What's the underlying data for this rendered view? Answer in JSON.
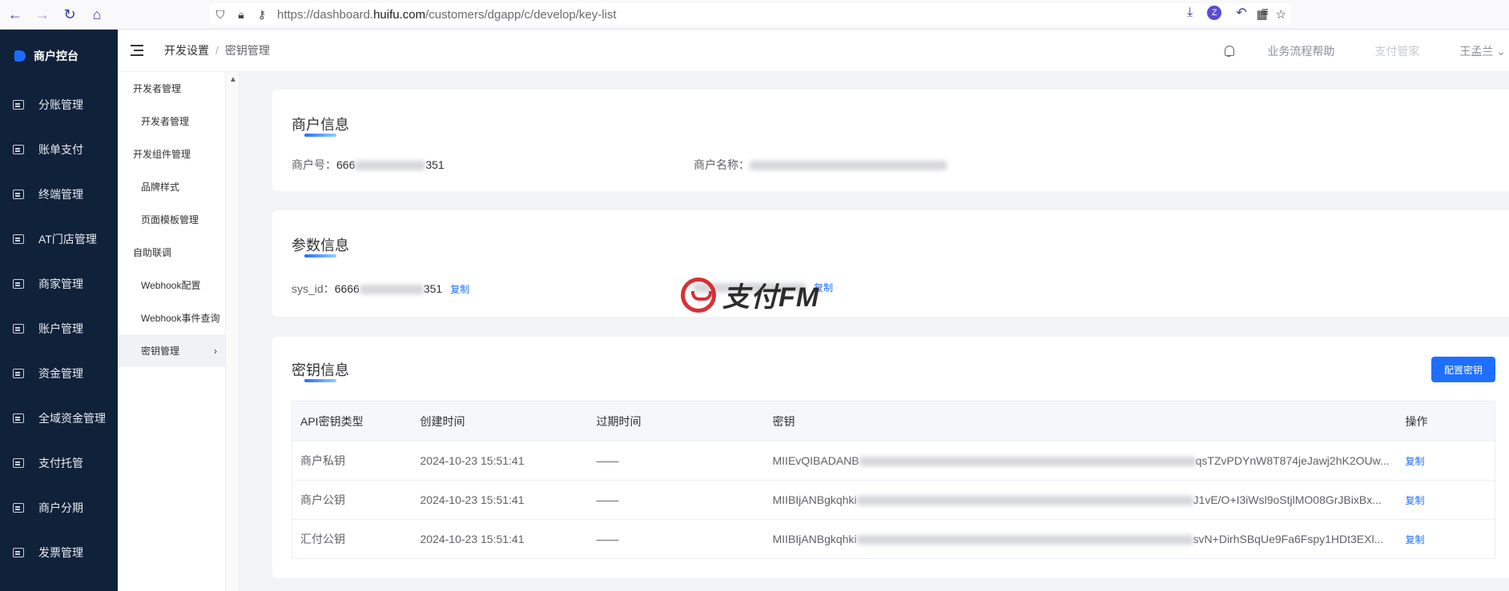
{
  "browser": {
    "url_prefix": "https://dashboard.",
    "url_domain": "huifu.com",
    "url_path": "/customers/dgapp/c/develop/key-list",
    "profile_initial": "Z"
  },
  "sidebar": {
    "logo_label": "商户控台",
    "items": [
      {
        "label": "分账管理"
      },
      {
        "label": "账单支付"
      },
      {
        "label": "终端管理"
      },
      {
        "label": "AT门店管理"
      },
      {
        "label": "商家管理"
      },
      {
        "label": "账户管理"
      },
      {
        "label": "资金管理"
      },
      {
        "label": "全域资金管理"
      },
      {
        "label": "支付托管"
      },
      {
        "label": "商户分期"
      },
      {
        "label": "发票管理"
      }
    ]
  },
  "header": {
    "breadcrumb_parent": "开发设置",
    "breadcrumb_sep": "/",
    "breadcrumb_current": "密钥管理",
    "help_link": "业务流程帮助",
    "pay_link": "支付管家",
    "user_name": "王孟兰"
  },
  "submenu": {
    "groups": [
      {
        "label": "开发者管理",
        "items": [
          "开发者管理"
        ]
      },
      {
        "label": "开发组件管理",
        "items": [
          "品牌样式",
          "页面模板管理"
        ]
      },
      {
        "label": "自助联调",
        "items": [
          "Webhook配置",
          "Webhook事件查询",
          "密钥管理"
        ]
      }
    ],
    "active_label": "密钥管理"
  },
  "merchant_card": {
    "title": "商户信息",
    "merchant_no_label": "商户号：",
    "merchant_no_prefix": "666",
    "merchant_no_suffix": "351",
    "merchant_name_label": "商户名称："
  },
  "params_card": {
    "title": "参数信息",
    "sys_id_label": "sys_id：",
    "sys_id_prefix": "6666",
    "sys_id_suffix": "351",
    "copy_label": "复制"
  },
  "keys_card": {
    "title": "密钥信息",
    "config_button": "配置密钥",
    "columns": [
      "API密钥类型",
      "创建时间",
      "过期时间",
      "密钥",
      "操作"
    ],
    "rows": [
      {
        "type": "商户私钥",
        "created": "2024-10-23 15:51:41",
        "expires": "——",
        "key_head": "MIIEvQIBADANB",
        "key_tail": "qsTZvPDYnW8T874jeJawj2hK2OUw...",
        "action": "复制"
      },
      {
        "type": "商户公钥",
        "created": "2024-10-23 15:51:41",
        "expires": "——",
        "key_head": "MIIBIjANBgkqhki",
        "key_tail": "J1vE/O+I3iWsl9oStjlMO08GrJBixBx...",
        "action": "复制"
      },
      {
        "type": "汇付公钥",
        "created": "2024-10-23 15:51:41",
        "expires": "——",
        "key_head": "MIIBIjANBgkqhki",
        "key_tail": "svN+DirhSBqUe9Fa6Fspy1HDt3EXl...",
        "action": "复制"
      }
    ]
  },
  "watermark": {
    "text": "支付FM"
  }
}
